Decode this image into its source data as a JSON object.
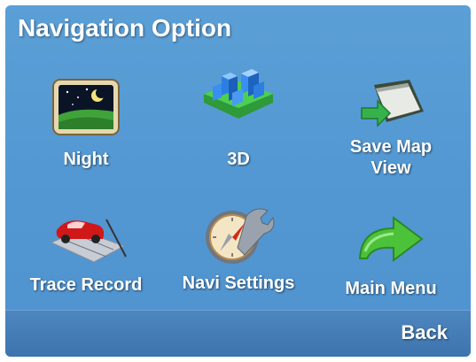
{
  "header": {
    "title": "Navigation Option"
  },
  "menu": {
    "items": [
      {
        "label": "Night",
        "icon": "night-icon"
      },
      {
        "label": "3D",
        "icon": "3d-icon"
      },
      {
        "label": "Save Map View",
        "label_line1": "Save Map",
        "label_line2": "View",
        "icon": "save-map-view-icon"
      },
      {
        "label": "Trace Record",
        "icon": "trace-record-icon"
      },
      {
        "label": "Navi Settings",
        "icon": "navi-settings-icon"
      },
      {
        "label": "Main Menu",
        "icon": "main-menu-icon"
      }
    ]
  },
  "footer": {
    "back_label": "Back"
  },
  "colors": {
    "background": "#5297d2",
    "footer_bar": "#3d74ae",
    "text": "#ffffff"
  }
}
